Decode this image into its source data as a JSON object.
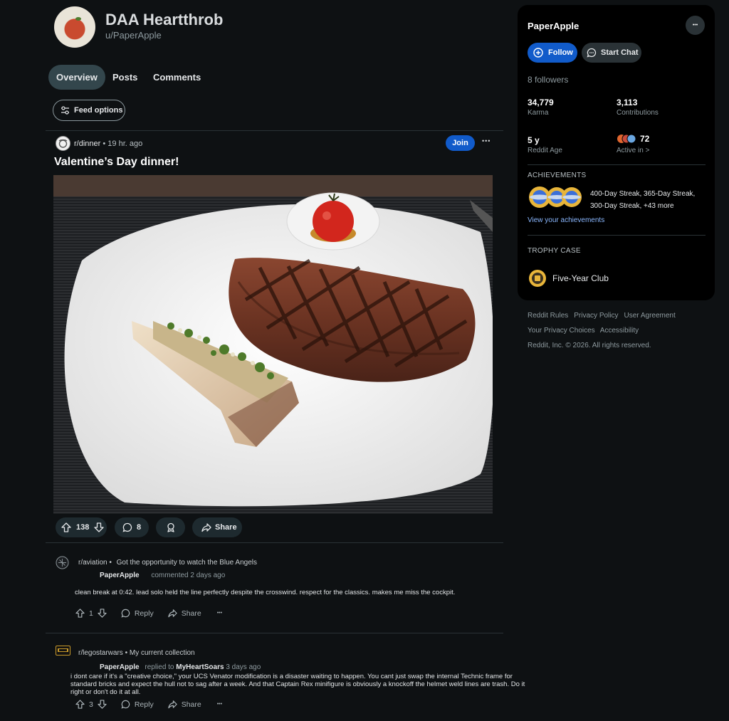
{
  "profile": {
    "display_name": "DAA Heartthrob",
    "username": "u/PaperApple"
  },
  "tabs": [
    {
      "label": "Overview",
      "active": true
    },
    {
      "label": "Posts",
      "active": false
    },
    {
      "label": "Comments",
      "active": false
    }
  ],
  "feed_options_label": "Feed options",
  "post": {
    "subreddit": "r/dinner",
    "separator": "•",
    "time": "19 hr. ago",
    "join_label": "Join",
    "more_label": "•••",
    "title": "Valentine’s Day dinner!",
    "image_icon": "steak-dinner-photo",
    "upvotes": "138",
    "comments": "8",
    "share_label": "Share"
  },
  "comments": [
    {
      "subreddit": "r/aviation",
      "bullet": "•",
      "post_title": "Got the opportunity to watch the Blue Angels",
      "author": "PaperApple",
      "meta": "commented 2 days ago",
      "text": "clean break at 0:42. lead solo held the line perfectly despite the crosswind. respect for the classics. makes me miss the cockpit.",
      "score": "1",
      "reply_label": "Reply",
      "share_label": "Share",
      "more_label": "•••"
    },
    {
      "subreddit": "r/legostarwars",
      "bullet": "•",
      "post_title": "My current collection",
      "author": "PaperApple",
      "meta_prefix": "replied to",
      "reply_to": "MyHeartSoars",
      "meta_time": "3 days ago",
      "text": "i dont care if it's a \"creative choice,\" your UCS Venator modification is a disaster waiting to happen. You cant just swap the internal Technic frame for standard bricks and expect the hull not to sag after a week. And that Captain Rex minifigure is obviously a knockoff the helmet weld lines are trash. Do it right or don't do it at all.",
      "score": "3",
      "reply_label": "Reply",
      "share_label": "Share",
      "more_label": "•••"
    }
  ],
  "sidebar": {
    "name": "PaperApple",
    "more_label": "•••",
    "follow_label": "Follow",
    "chat_label": "Start Chat",
    "followers": "8 followers",
    "karma_value": "34,779",
    "karma_label": "Karma",
    "contrib_value": "3,113",
    "contrib_label": "Contributions",
    "age_value": "5 y",
    "age_label": "Reddit Age",
    "active_value": "72",
    "active_label": "Active in >",
    "achievements_heading": "ACHIEVEMENTS",
    "achievements_line1": "400-Day Streak, 365-Day Streak,",
    "achievements_line2": "300-Day Streak, +43 more",
    "achievements_link": "View your achievements",
    "trophy_heading": "TROPHY CASE",
    "trophy_name": "Five-Year Club"
  },
  "footer": {
    "links_row1": [
      "Reddit Rules",
      "Privacy Policy",
      "User Agreement"
    ],
    "links_row2": [
      "Your Privacy Choices",
      "Accessibility"
    ],
    "copyright": "Reddit, Inc. © 2026. All rights reserved."
  },
  "colors": {
    "background": "#0e1113",
    "accent_blue": "#115bca",
    "card": "#000000",
    "pill": "#1e2a2f"
  }
}
